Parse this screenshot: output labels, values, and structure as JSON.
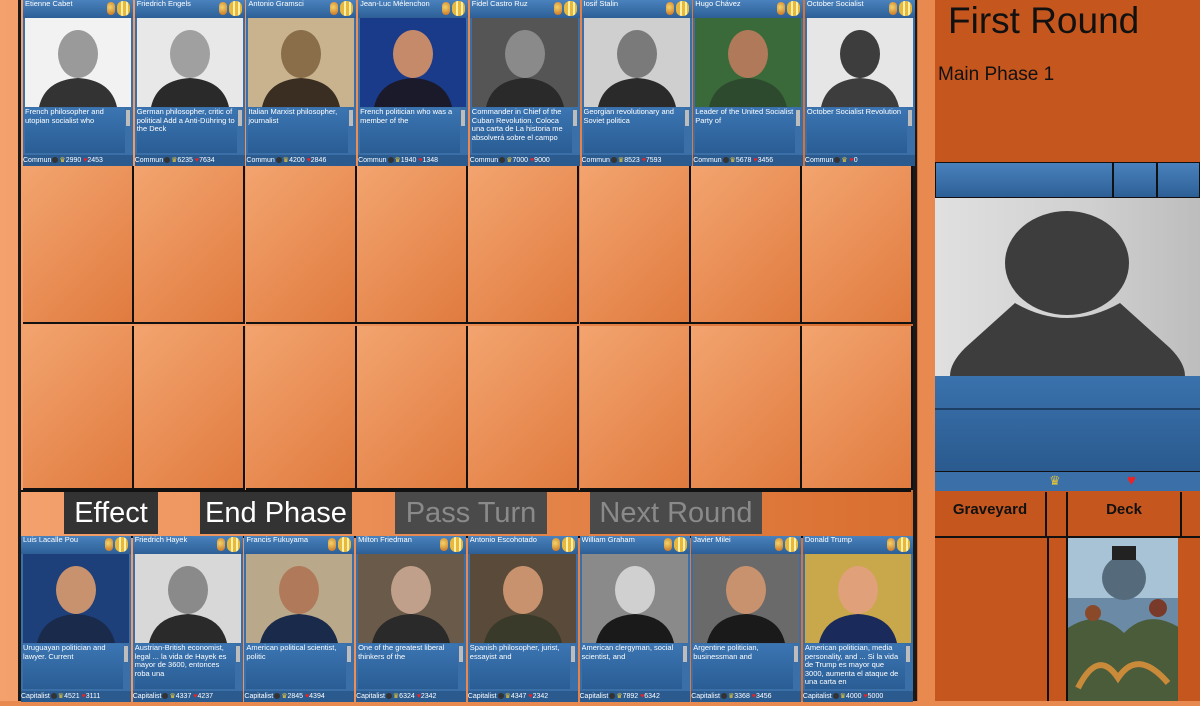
{
  "round_title": "First Round",
  "phase_label": "Main Phase 1",
  "buttons": {
    "effect": "Effect",
    "end_phase": "End Phase",
    "pass_turn": "Pass Turn",
    "next_round": "Next Round"
  },
  "graveyard_label": "Graveyard",
  "deck_label": "Deck",
  "opponent_hand": [
    {
      "name": "Etienne Cabet",
      "desc": "French philosopher and utopian socialist who",
      "faction": "Commun",
      "atk": "2990",
      "hp": "2453"
    },
    {
      "name": "Friedrich Engels",
      "desc": "German philosopher, critic of political Add a Anti-Dühring to the Deck",
      "faction": "Commun",
      "atk": "6235",
      "hp": "7634"
    },
    {
      "name": "Antonio Gramsci",
      "desc": "Italian Marxist philosopher, journalist",
      "faction": "Commun",
      "atk": "4200",
      "hp": "2846"
    },
    {
      "name": "Jean-Luc Mélenchon",
      "desc": "French politician who was a member of the",
      "faction": "Commun",
      "atk": "1940",
      "hp": "1348"
    },
    {
      "name": "Fidel Castro Ruz",
      "desc": "Commander in Chief of the Cuban Revolution. Coloca una carta de La historia me absolverá sobre el campo",
      "faction": "Commun",
      "atk": "7000",
      "hp": "9000"
    },
    {
      "name": "Iosif Stalin",
      "desc": "Georgian revolutionary and Soviet politica",
      "faction": "Commun",
      "atk": "8523",
      "hp": "7593"
    },
    {
      "name": "Hugo Chávez",
      "desc": "Leader of the United Socialist Party of",
      "faction": "Commun",
      "atk": "5678",
      "hp": "3456"
    },
    {
      "name": "October Socialist",
      "desc": "October Socialist Revolution",
      "faction": "Commun",
      "atk": "",
      "hp": "0"
    }
  ],
  "player_hand": [
    {
      "name": "Luis Lacalle Pou",
      "desc": "Uruguayan politician and lawyer. Current",
      "faction": "Capitalist",
      "atk": "4521",
      "hp": "3111"
    },
    {
      "name": "Friedrich Hayek",
      "desc": "Austrian-British economist, legal ... la vida de Hayek es mayor de 3600, entonces roba una",
      "faction": "Capitalist",
      "atk": "4337",
      "hp": "4237"
    },
    {
      "name": "Francis Fukuyama",
      "desc": "American political scientist, politic",
      "faction": "Capitalist",
      "atk": "2845",
      "hp": "4394"
    },
    {
      "name": "Milton Friedman",
      "desc": "One of the greatest liberal thinkers of the",
      "faction": "Capitalist",
      "atk": "6324",
      "hp": "2342"
    },
    {
      "name": "Antonio Escohotado",
      "desc": "Spanish philosopher, jurist, essayist and",
      "faction": "Capitalist",
      "atk": "4347",
      "hp": "2342"
    },
    {
      "name": "William Graham",
      "desc": "American clergyman, social scientist, and",
      "faction": "Capitalist",
      "atk": "7892",
      "hp": "6342"
    },
    {
      "name": "Javier Milei",
      "desc": "Argentine politician, businessman and",
      "faction": "Capitalist",
      "atk": "3368",
      "hp": "3456"
    },
    {
      "name": "Donald Trump",
      "desc": "American politician, media personality, and ... Si la vida de Trump es mayor que 3000, aumenta el ataque de una carta en",
      "faction": "Capitalist",
      "atk": "4000",
      "hp": "5000"
    }
  ]
}
